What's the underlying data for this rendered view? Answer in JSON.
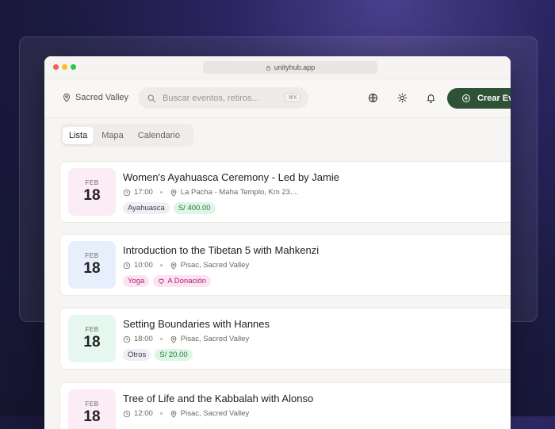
{
  "browser": {
    "url": "unityhub.app"
  },
  "header": {
    "location": "Sacred Valley",
    "search_placeholder": "Buscar eventos, retiros...",
    "search_shortcut": "⌘K",
    "create_label": "Crear Ev"
  },
  "tabs": [
    {
      "label": "Lista",
      "active": true
    },
    {
      "label": "Mapa",
      "active": false
    },
    {
      "label": "Calendario",
      "active": false
    }
  ],
  "events": [
    {
      "month": "FEB",
      "day": "18",
      "title": "Women's Ayahuasca Ceremony - Led by Jamie",
      "time": "17:00",
      "place": "La Pacha - Maha Templo, Km 23....",
      "tags": [
        {
          "label": "Ayahuasca",
          "bg": "#eeeff4",
          "fg": "#3c3e4a"
        },
        {
          "label": "S/ 400.00",
          "bg": "#dff5e6",
          "fg": "#1f7a3d"
        }
      ],
      "date_bg": "#fcecf6"
    },
    {
      "month": "FEB",
      "day": "18",
      "title": "Introduction to the Tibetan 5 with Mahkenzi",
      "time": "10:00",
      "place": "Pisac, Sacred Valley",
      "tags": [
        {
          "label": "Yoga",
          "bg": "#fbe3f3",
          "fg": "#b0226f"
        },
        {
          "label": "A Donación",
          "bg": "#fbe3f3",
          "fg": "#b0226f",
          "icon": "heart-icon"
        }
      ],
      "date_bg": "#e8effc"
    },
    {
      "month": "FEB",
      "day": "18",
      "title": "Setting Boundaries with Hannes",
      "time": "18:00",
      "place": "Pisac, Sacred Valley",
      "tags": [
        {
          "label": "Otros",
          "bg": "#eeeff4",
          "fg": "#3c3e4a"
        },
        {
          "label": "S/ 20.00",
          "bg": "#dff5e6",
          "fg": "#1f7a3d"
        }
      ],
      "date_bg": "#e5f7ee"
    },
    {
      "month": "FEB",
      "day": "18",
      "title": "Tree of Life and the Kabbalah with Alonso",
      "time": "12:00",
      "place": "Pisac, Sacred Valley",
      "tags": [],
      "date_bg": "#fcecf6"
    }
  ],
  "icons": {
    "location": "map-pin-icon",
    "search": "search-icon",
    "globe": "globe-icon",
    "theme": "sun-icon",
    "notifications": "bell-icon",
    "create": "plus-circle-icon",
    "time": "clock-icon",
    "place": "map-pin-icon"
  },
  "colors": {
    "accent": "#2f5237",
    "background": "#1b1a40"
  }
}
